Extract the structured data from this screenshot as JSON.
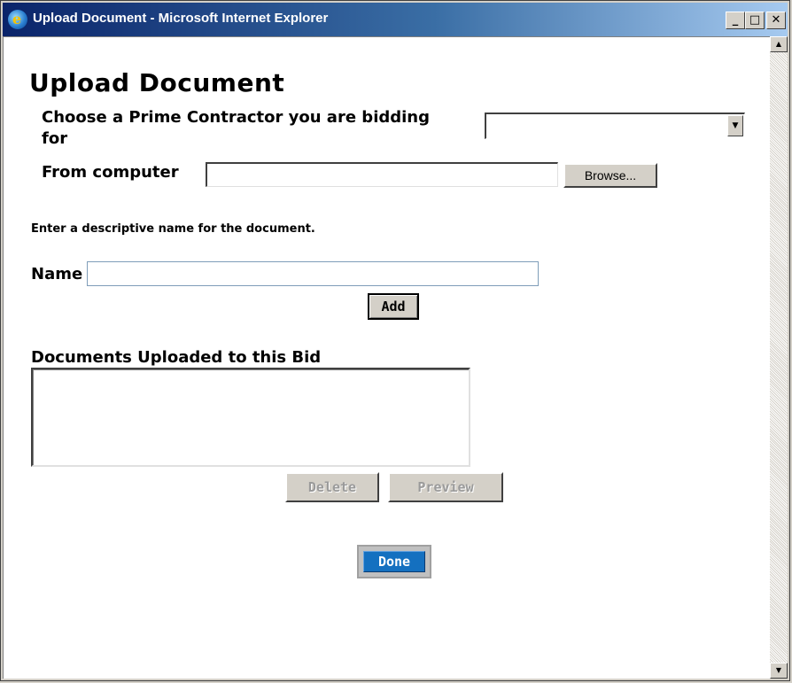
{
  "window": {
    "title": "Upload Document - Microsoft Internet Explorer",
    "controls": {
      "minimize": "_",
      "maximize": "□",
      "close": "✕"
    },
    "icon": "ie-icon"
  },
  "page": {
    "title": "Upload Document",
    "prime_contractor_label": "Choose a Prime Contractor you are bidding for",
    "prime_contractor_selected": "",
    "from_computer_label": "From computer",
    "file_path_value": "",
    "browse_label": "Browse...",
    "descriptive_note": "Enter a descriptive name for the document.",
    "name_label": "Name",
    "name_value": "",
    "add_label": "Add",
    "documents_heading": "Documents Uploaded to this Bid",
    "documents": [],
    "delete_label": "Delete",
    "preview_label": "Preview",
    "done_label": "Done"
  },
  "scrollbar": {
    "up_arrow": "▲",
    "down_arrow": "▼"
  },
  "colors": {
    "titlebar_start": "#0a246a",
    "titlebar_end": "#a6caf0",
    "done_button": "#1470c0",
    "disabled_text": "#9a9a9a"
  }
}
